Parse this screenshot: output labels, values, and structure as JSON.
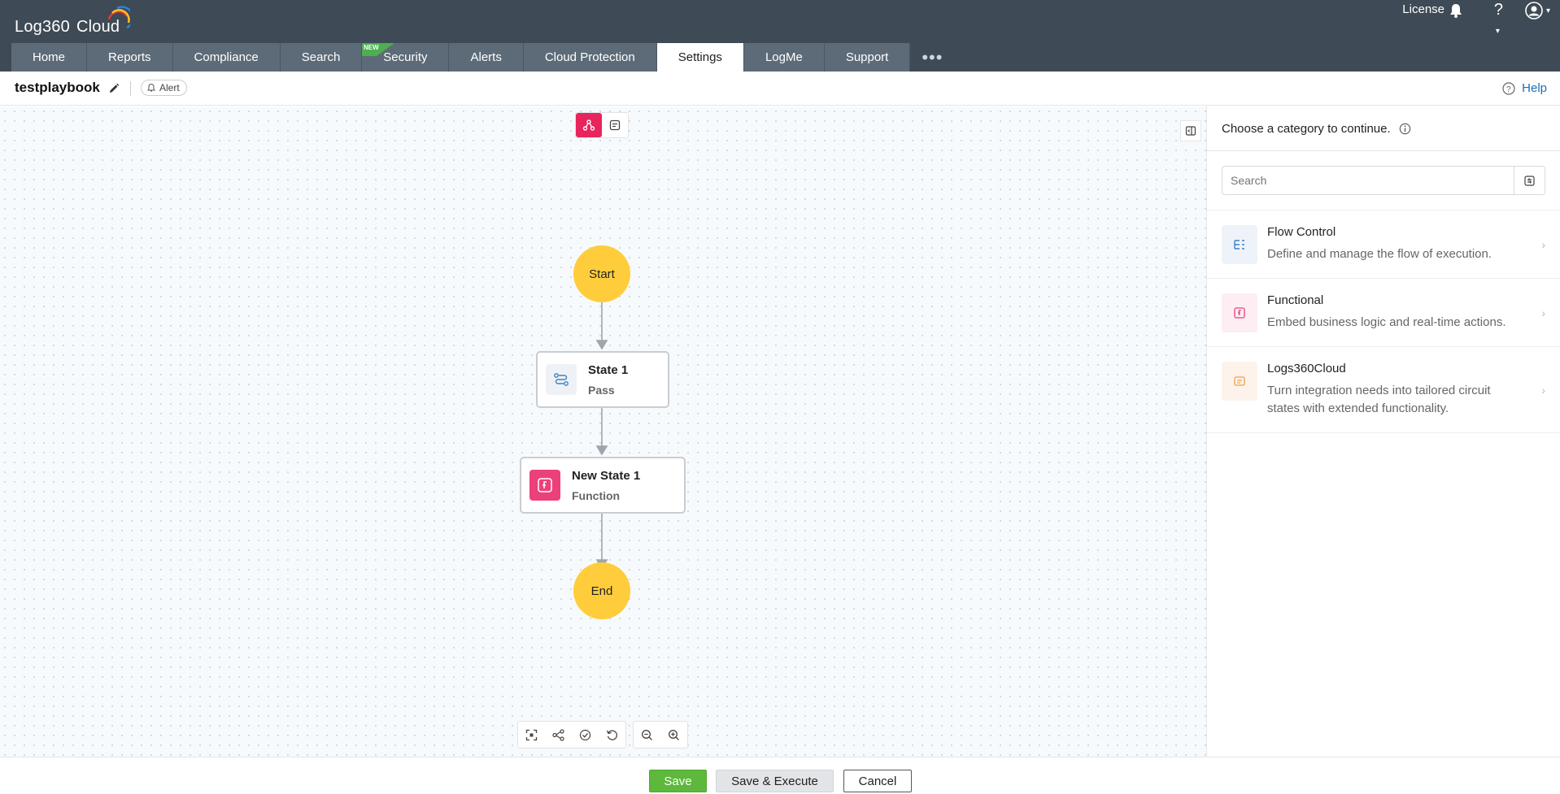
{
  "app": {
    "logo_text": "Log360",
    "logo_sub": "Cloud",
    "license": "License"
  },
  "tabs": [
    {
      "label": "Home"
    },
    {
      "label": "Reports"
    },
    {
      "label": "Compliance"
    },
    {
      "label": "Search"
    },
    {
      "label": "Security",
      "badge": "NEW"
    },
    {
      "label": "Alerts"
    },
    {
      "label": "Cloud Protection"
    },
    {
      "label": "Settings",
      "active": true
    },
    {
      "label": "LogMe"
    },
    {
      "label": "Support"
    }
  ],
  "tabs_more": "•••",
  "header": {
    "playbook_name": "testplaybook",
    "chip": "Alert",
    "help": "Help"
  },
  "flow": {
    "start": "Start",
    "end": "End",
    "state1": {
      "title": "State 1",
      "type": "Pass"
    },
    "state2": {
      "title": "New State 1",
      "type": "Function"
    }
  },
  "panel": {
    "heading": "Choose a category to continue.",
    "search_placeholder": "Search",
    "categories": [
      {
        "name": "Flow Control",
        "desc": "Define and manage the flow of execution."
      },
      {
        "name": "Functional",
        "desc": "Embed business logic and real-time actions."
      },
      {
        "name": "Logs360Cloud",
        "desc": "Turn integration needs into tailored circuit states with extended functionality."
      }
    ]
  },
  "footer": {
    "save": "Save",
    "save_execute": "Save & Execute",
    "cancel": "Cancel"
  },
  "colors": {
    "topbar": "#3e4a55",
    "tab": "#5d6b78",
    "accent_pink": "#e8245d",
    "node_yellow": "#ffcd3c",
    "save_green": "#5db83c",
    "link_blue": "#1a6fb5"
  }
}
